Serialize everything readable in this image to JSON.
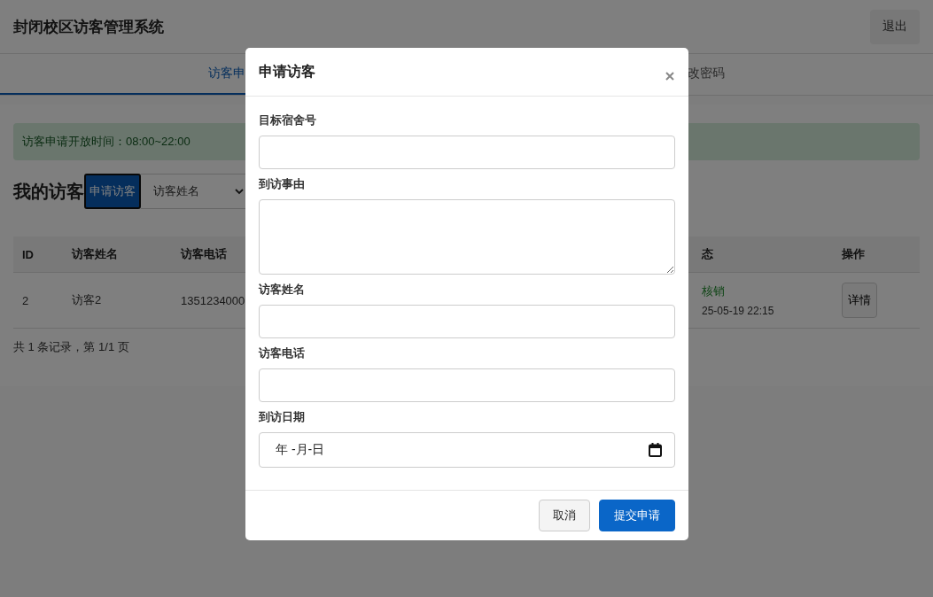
{
  "header": {
    "title": "封闭校区访客管理系统",
    "logout": "退出"
  },
  "tabs": [
    {
      "label": "访客申",
      "selected": true
    },
    {
      "label": "改密码",
      "selected": false
    }
  ],
  "notice": "访客申请开放时间：08:00~22:00",
  "section": {
    "title": "我的访客",
    "apply_button": "申请访客",
    "filter": {
      "value": "访客姓名"
    }
  },
  "table": {
    "columns": [
      "ID",
      "访客姓名",
      "访客电话",
      "态",
      "操作"
    ],
    "rows": [
      {
        "cells": [
          "2",
          "访客2",
          "1351234000"
        ],
        "status": "核销",
        "time": "25-05-19 22:15",
        "action": "详情"
      }
    ]
  },
  "pagination": "共 1 条记录，第 1/1 页",
  "dialog": {
    "title": "申请访客",
    "fields": [
      {
        "label": "目标宿舍号",
        "kind": "text"
      },
      {
        "label": "到访事由",
        "kind": "textarea"
      },
      {
        "label": "访客姓名",
        "kind": "text"
      },
      {
        "label": "访客电话",
        "kind": "text"
      },
      {
        "label": "到访日期",
        "kind": "date",
        "placeholder": "年 -月-日"
      }
    ],
    "buttons": [
      {
        "label": "取消",
        "kind": "secondary"
      },
      {
        "label": "提交申请",
        "kind": "primary"
      }
    ]
  }
}
